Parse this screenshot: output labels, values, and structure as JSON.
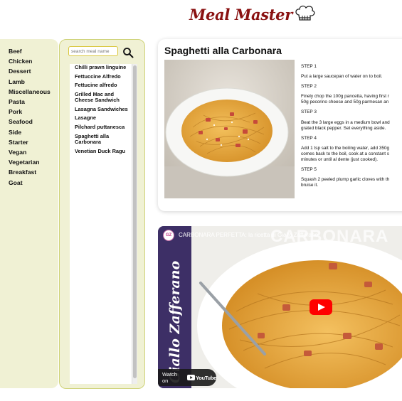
{
  "header": {
    "logo_text": "Meal Master"
  },
  "categories": [
    "Beef",
    "Chicken",
    "Dessert",
    "Lamb",
    "Miscellaneous",
    "Pasta",
    "Pork",
    "Seafood",
    "Side",
    "Starter",
    "Vegan",
    "Vegetarian",
    "Breakfast",
    "Goat"
  ],
  "meal_search": {
    "placeholder": "search meal name",
    "meals": [
      "Chilli prawn linguine",
      "Fettuccine Alfredo",
      "Fettucine alfredo",
      "Grilled Mac and Cheese Sandwich",
      "Lasagna Sandwiches",
      "Lasagne",
      "Pilchard puttanesca",
      "Spaghetti alla Carbonara",
      "Venetian Duck Ragu"
    ]
  },
  "recipe": {
    "title": "Spaghetti alla Carbonara",
    "steps": [
      {
        "heading": "STEP 1",
        "lines": [
          "Put a large saucepan of water on to boil."
        ]
      },
      {
        "heading": "STEP 2",
        "lines": [
          "Finely chop the 100g pancetta, having first r",
          "50g pecorino cheese and 50g parmesan an"
        ]
      },
      {
        "heading": "STEP 3",
        "lines": [
          "Beat the 3 large eggs in a medium bowl and",
          "grated black pepper. Set everything aside."
        ]
      },
      {
        "heading": "STEP 4",
        "lines": [
          "Add 1 tsp salt to the boiling water, add 350g",
          "comes back to the boil, cook at a constant s",
          "minutes or until al dente (just cooked)."
        ]
      },
      {
        "heading": "STEP 5",
        "lines": [
          "Squash 2 peeled plump garlic cloves with th",
          "bruise it."
        ]
      }
    ]
  },
  "video": {
    "title": "CARBONARA PERFETTA: la ricetta di Giallo Zafferano",
    "overlay_text": "CARBONARA",
    "watch_on": "Watch on",
    "platform": "YouTube",
    "channel_badge": "GZ",
    "brand_text": "Giallo Zafferano"
  },
  "colors": {
    "logo": "#8a1212",
    "panel_bg": "#f0f1d4",
    "panel_border": "#cfd37a",
    "video_sidebar": "#3d2f66"
  },
  "icons": {
    "search": "search-icon",
    "chef_hat": "chef-hat-icon",
    "play": "play-icon"
  }
}
